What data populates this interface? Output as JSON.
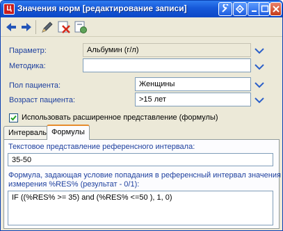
{
  "window": {
    "title": "Значения норм [редактирование записи]",
    "app_icon_glyph": "Ц"
  },
  "fields": {
    "parameter_label": "Параметр:",
    "parameter_value": "Альбумин (г/л)",
    "method_label": "Методика:",
    "method_value": "",
    "sex_label": "Пол пациента:",
    "sex_value": "Женщины",
    "age_label": "Возраст пациента:",
    "age_value": ">15 лет"
  },
  "extended_checkbox": {
    "label": "Использовать расширенное представление (формулы)",
    "checked": true
  },
  "tabs": [
    {
      "label": "Интервалы",
      "active": false
    },
    {
      "label": "Формулы",
      "active": true
    }
  ],
  "formulas": {
    "text_label": "Текстовое представление референсного интервала:",
    "text_value": "35-50",
    "formula_label_line1": "Формула, задающая условие попадания в референсный интервал значения",
    "formula_label_line2": "измерения %RES% (результат - 0/1):",
    "formula_value": "IF ((%RES% >= 35) and (%RES% <=50 ), 1, 0)"
  },
  "colors": {
    "titlebar": "#0c47c6",
    "label_text": "#1d3f9e",
    "window_bg": "#ece9d8",
    "chevron": "#2b5fc9"
  },
  "icons": [
    "tools-icon",
    "help-icon",
    "minimize-icon",
    "maximize-icon",
    "close-icon",
    "arrow-left-icon",
    "arrow-right-icon",
    "pen-icon",
    "delete-icon",
    "clear-icon",
    "chevron-down-icon",
    "checkmark-icon"
  ]
}
